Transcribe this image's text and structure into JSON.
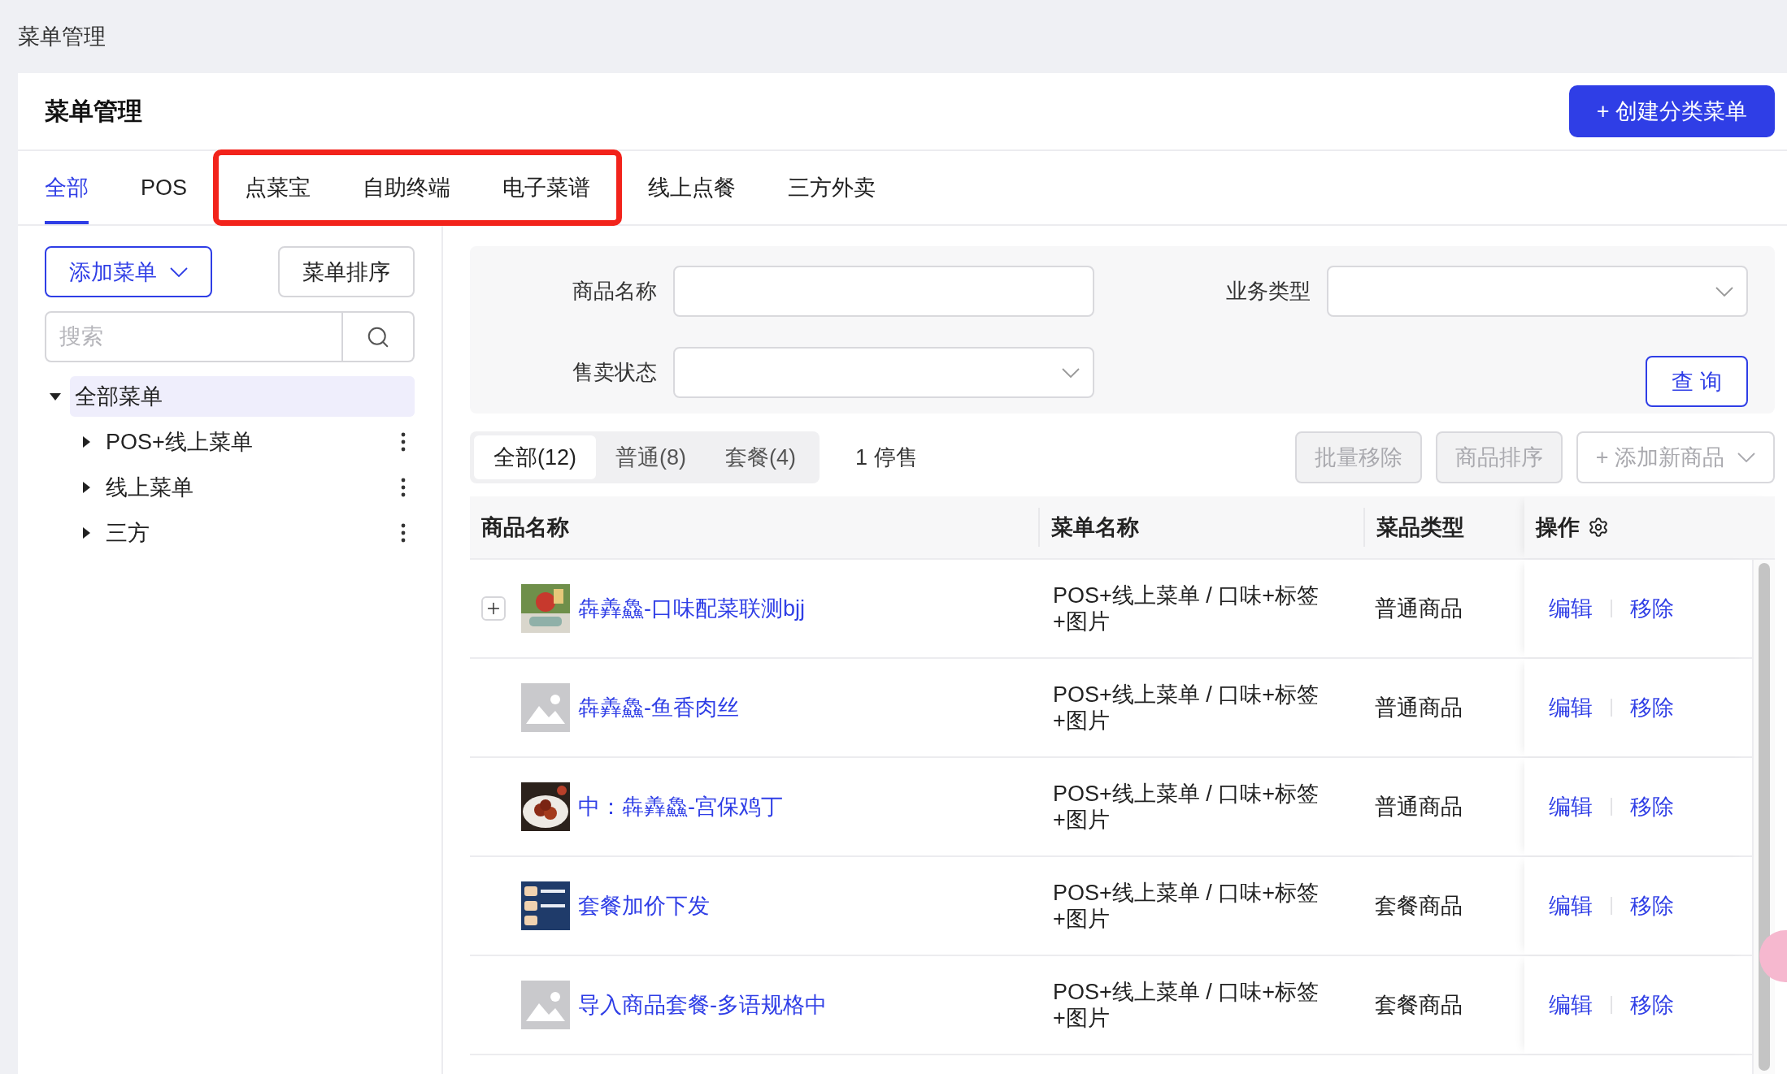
{
  "breadcrumb": "菜单管理",
  "page_title": "菜单管理",
  "create_button": "+ 创建分类菜单",
  "tabs": [
    {
      "label": "全部",
      "selected": true,
      "highlighted": false
    },
    {
      "label": "POS",
      "selected": false,
      "highlighted": false
    },
    {
      "label": "点菜宝",
      "selected": false,
      "highlighted": true
    },
    {
      "label": "自助终端",
      "selected": false,
      "highlighted": true
    },
    {
      "label": "电子菜谱",
      "selected": false,
      "highlighted": true
    },
    {
      "label": "线上点餐",
      "selected": false,
      "highlighted": false
    },
    {
      "label": "三方外卖",
      "selected": false,
      "highlighted": false
    }
  ],
  "sidebar": {
    "add_button": "添加菜单",
    "sort_button": "菜单排序",
    "search": {
      "placeholder": "搜索"
    },
    "tree": [
      {
        "label": "全部菜单",
        "selected": true,
        "expanded": true,
        "children": [
          {
            "label": "POS+线上菜单",
            "selected": false,
            "expanded": false
          },
          {
            "label": "线上菜单",
            "selected": false,
            "expanded": false
          },
          {
            "label": "三方",
            "selected": false,
            "expanded": false
          }
        ]
      }
    ]
  },
  "filters": [
    {
      "label": "商品名称",
      "kind": "text"
    },
    {
      "label": "业务类型",
      "kind": "select"
    },
    {
      "label": "售卖状态",
      "kind": "select"
    }
  ],
  "query_button": "查 询",
  "segments": [
    {
      "label": "全部(12)",
      "selected": true
    },
    {
      "label": "普通(8)",
      "selected": false
    },
    {
      "label": "套餐(4)",
      "selected": false
    }
  ],
  "stopped_count": "1 停售",
  "actions": [
    {
      "label": "批量移除",
      "kind": "button",
      "disabled": true
    },
    {
      "label": "商品排序",
      "kind": "button",
      "disabled": true
    },
    {
      "label": "+ 添加新商品",
      "kind": "dropdown",
      "disabled": true
    }
  ],
  "table": {
    "columns": [
      "商品名称",
      "菜单名称",
      "菜品类型",
      "操作"
    ],
    "rows": [
      {
        "name": "犇羴鱻-口味配菜联测bjj",
        "expandable": true,
        "thumbnail": {
          "kind": "picture"
        },
        "menu": "POS+线上菜单 / 口味+标签\n+图片",
        "type": "普通商品",
        "operations": [
          "编辑",
          "移除"
        ]
      },
      {
        "name": "犇羴鱻-鱼香肉丝",
        "expandable": false,
        "thumbnail": {
          "kind": "placeholder"
        },
        "menu": "POS+线上菜单 / 口味+标签\n+图片",
        "type": "普通商品",
        "operations": [
          "编辑",
          "移除"
        ]
      },
      {
        "name": "中：犇羴鱻-宫保鸡丁",
        "expandable": false,
        "thumbnail": {
          "kind": "picture"
        },
        "menu": "POS+线上菜单 / 口味+标签\n+图片",
        "type": "普通商品",
        "operations": [
          "编辑",
          "移除"
        ]
      },
      {
        "name": "套餐加价下发",
        "expandable": false,
        "thumbnail": {
          "kind": "picture"
        },
        "menu": "POS+线上菜单 / 口味+标签\n+图片",
        "type": "套餐商品",
        "operations": [
          "编辑",
          "移除"
        ]
      },
      {
        "name": "导入商品套餐-多语规格中",
        "expandable": false,
        "thumbnail": {
          "kind": "placeholder"
        },
        "menu": "POS+线上菜单 / 口味+标签\n+图片",
        "type": "套餐商品",
        "operations": [
          "编辑",
          "移除"
        ]
      }
    ]
  }
}
